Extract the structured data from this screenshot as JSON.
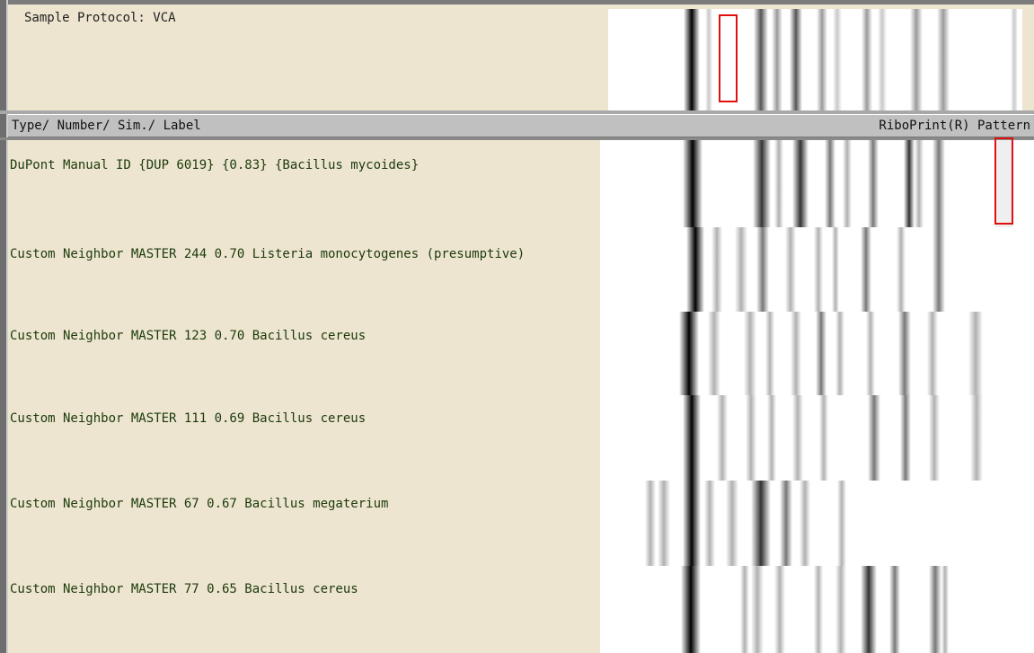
{
  "sample": {
    "protocol_text": "Sample Protocol: VCA"
  },
  "header": {
    "left_label": "Type/ Number/ Sim./ Label",
    "right_label": "RiboPrint(R) Pattern"
  },
  "rows": [
    {
      "label": "DuPont Manual ID {DUP 6019} {0.83} {Bacillus mycoides}"
    },
    {
      "label": "Custom Neighbor MASTER 244 0.70 Listeria monocytogenes (presumptive)"
    },
    {
      "label": "Custom Neighbor MASTER 123 0.70 Bacillus cereus"
    },
    {
      "label": "Custom Neighbor MASTER 111 0.69 Bacillus cereus"
    },
    {
      "label": "Custom Neighbor MASTER 67 0.67 Bacillus megaterium"
    },
    {
      "label": "Custom Neighbor MASTER 77 0.65 Bacillus cereus"
    }
  ],
  "colors": {
    "label_background": "#ede5cf",
    "header_background": "#c0c0c0",
    "row_text": "#1c3a0c",
    "selection": "#e01010"
  }
}
